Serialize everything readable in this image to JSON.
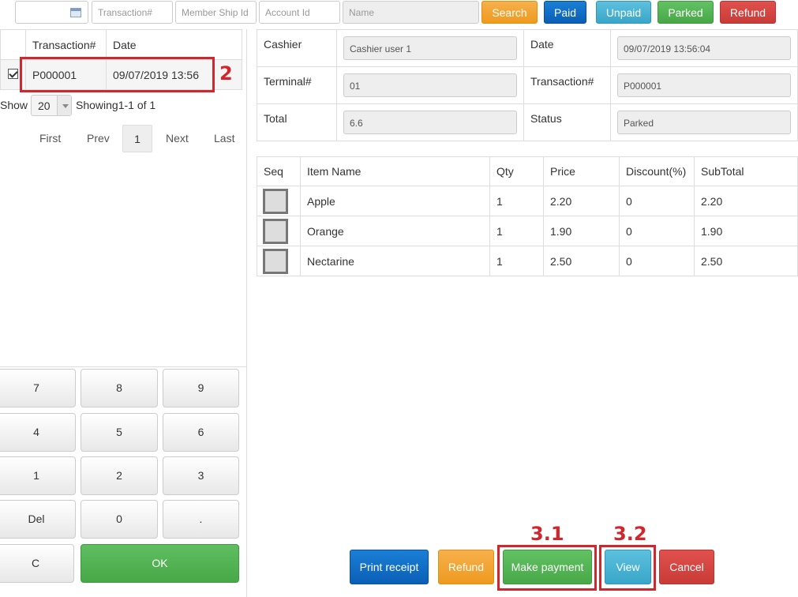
{
  "filters": {
    "date_placeholder": "",
    "transaction_placeholder": "Transaction#",
    "membership_placeholder": "Member Ship Id",
    "account_placeholder": "Account Id",
    "name_placeholder": "Name",
    "buttons": {
      "search": "Search",
      "paid": "Paid",
      "unpaid": "Unpaid",
      "parked": "Parked",
      "refund": "Refund"
    }
  },
  "list": {
    "headers": {
      "transaction": "Transaction#",
      "date": "Date"
    },
    "rows": [
      {
        "checked": true,
        "transaction": "P000001",
        "date": "09/07/2019 13:56"
      }
    ],
    "show_label": "Show",
    "page_size": "20",
    "showing": "Showing1-1 of 1",
    "pager": {
      "first": "First",
      "prev": "Prev",
      "current": "1",
      "next": "Next",
      "last": "Last"
    }
  },
  "keypad": {
    "keys": [
      "7",
      "8",
      "9",
      "4",
      "5",
      "6",
      "1",
      "2",
      "3",
      "Del",
      "0",
      "."
    ],
    "clear": "C",
    "ok": "OK"
  },
  "detail": {
    "cashier_label": "Cashier",
    "cashier_value": "Cashier user 1",
    "date_label": "Date",
    "date_value": "09/07/2019 13:56:04",
    "terminal_label": "Terminal#",
    "terminal_value": "01",
    "transaction_label": "Transaction#",
    "transaction_value": "P000001",
    "total_label": "Total",
    "total_value": "6.6",
    "status_label": "Status",
    "status_value": "Parked"
  },
  "items": {
    "headers": {
      "seq": "Seq",
      "name": "Item Name",
      "qty": "Qty",
      "price": "Price",
      "discount": "Discount(%)",
      "subtotal": "SubTotal"
    },
    "rows": [
      {
        "name": "Apple",
        "qty": "1",
        "price": "2.20",
        "discount": "0",
        "subtotal": "2.20"
      },
      {
        "name": "Orange",
        "qty": "1",
        "price": "1.90",
        "discount": "0",
        "subtotal": "1.90"
      },
      {
        "name": "Nectarine",
        "qty": "1",
        "price": "2.50",
        "discount": "0",
        "subtotal": "2.50"
      }
    ]
  },
  "actions": {
    "print": "Print receipt",
    "refund": "Refund",
    "make_payment": "Make payment",
    "view": "View",
    "cancel": "Cancel"
  },
  "annotations": {
    "row": "2",
    "make_payment": "3.1",
    "view": "3.2"
  },
  "colors": {
    "annotation": "#d0262d",
    "search": "#ee9a1e",
    "paid": "#0a5fb6",
    "unpaid": "#39a6c9",
    "parked": "#48a848",
    "refund": "#c93b36"
  }
}
